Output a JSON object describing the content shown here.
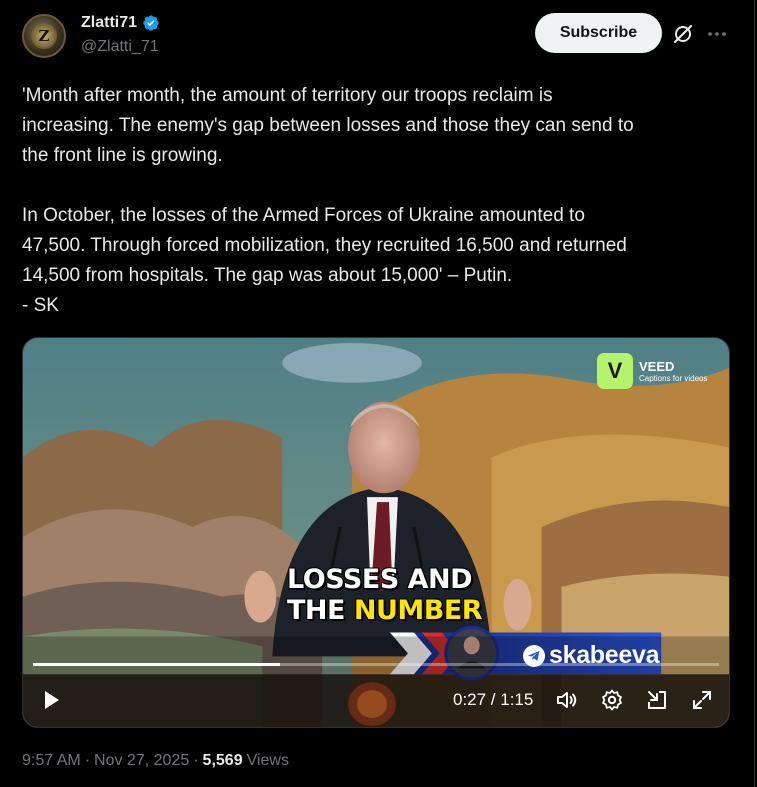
{
  "author": {
    "display_name": "Zlatti71",
    "handle": "@Zlatti_71",
    "avatar_letter": "Z",
    "verified": true
  },
  "header": {
    "subscribe_label": "Subscribe",
    "grok_icon": "grok-icon",
    "more_icon": "more-icon"
  },
  "tweet": {
    "paragraph1_lines": [
      "'Month after month, the amount of territory our troops reclaim is",
      "increasing. The enemy's gap between losses and those they can send to",
      "the front line is growing."
    ],
    "paragraph2_lines": [
      "In October, the losses of the Armed Forces of Ukraine amounted to",
      "47,500. Through forced mobilization, they recruited 16,500 and returned",
      "14,500 from hospitals. The gap was about 15,000' – Putin.",
      "- SK"
    ]
  },
  "video": {
    "watermark_title": "VEED",
    "watermark_sub": "Captions for videos",
    "watermark_logo": "V",
    "caption_line1": "LOSSES AND",
    "caption_line2_prefix": "THE ",
    "caption_line2_highlight": "NUMBER",
    "channel_name": "skabeeva",
    "current_time": "0:27",
    "duration": "1:15",
    "time_display": "0:27 / 1:15",
    "progress": 0.36,
    "controls": [
      "play-icon",
      "volume-icon",
      "settings-icon",
      "pip-icon",
      "fullscreen-icon"
    ]
  },
  "footer": {
    "time": "9:57 AM",
    "separator": "·",
    "date": "Nov 27, 2025",
    "views_count": "5,569",
    "views_label": "Views"
  },
  "colors": {
    "background": "#000000",
    "text": "#e7e9ea",
    "muted": "#71767b",
    "verified_blue": "#1d9bf0",
    "caption_highlight": "#ffe600",
    "veed_green": "#b4f36b"
  }
}
